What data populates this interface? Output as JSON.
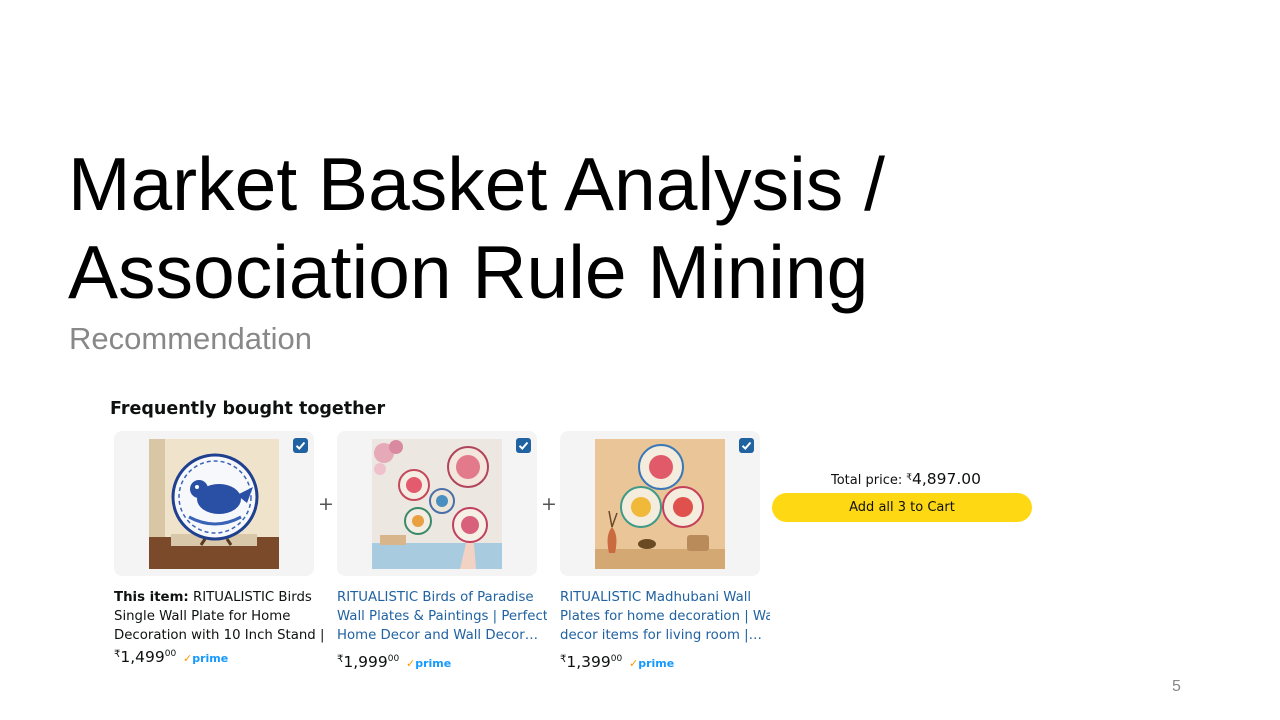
{
  "slide": {
    "title_line1": "Market Basket Analysis /",
    "title_line2": "Association Rule Mining",
    "subtitle": "Recommendation",
    "page_number": "5"
  },
  "widget": {
    "heading": "Frequently bought together",
    "plus": "+",
    "products": [
      {
        "badge": "This item:",
        "lines": [
          "RITUALISTIC Birds",
          "Single Wall Plate for Home",
          "Decoration with 10 Inch Stand |…"
        ],
        "price_symbol": "₹",
        "price_whole": "1,499",
        "price_fraction": "00",
        "prime_label": "prime",
        "checked": true
      },
      {
        "badge": "",
        "lines": [
          "RITUALISTIC Birds of Paradise",
          "Wall Plates & Paintings | Perfect",
          "Home Decor and Wall Decor…"
        ],
        "price_symbol": "₹",
        "price_whole": "1,999",
        "price_fraction": "00",
        "prime_label": "prime",
        "checked": true
      },
      {
        "badge": "",
        "lines": [
          "RITUALISTIC Madhubani Wall",
          "Plates for home decoration | Wall",
          "decor items for living room |…"
        ],
        "price_symbol": "₹",
        "price_whole": "1,399",
        "price_fraction": "00",
        "prime_label": "prime",
        "checked": true
      }
    ],
    "total_label": "Total price:",
    "total_symbol": "₹",
    "total_amount": "4,897.00",
    "cart_button": "Add all 3 to Cart",
    "colors": {
      "link": "#2162a1",
      "checkbox": "#2162a1",
      "button": "#ffd814",
      "prime": "#1399ff",
      "prime_check": "#ff9900",
      "card_bg": "#f4f4f5"
    }
  }
}
